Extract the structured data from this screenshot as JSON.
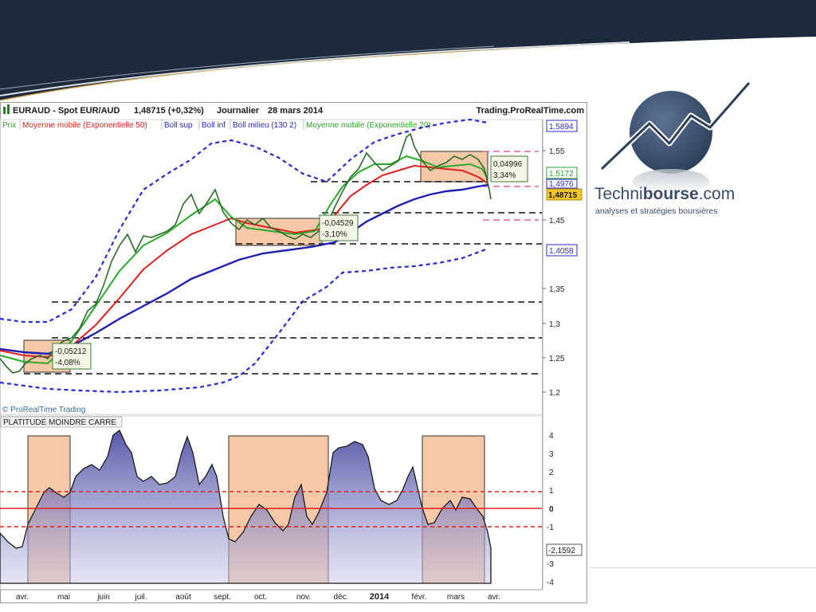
{
  "header": {
    "title": "EURAUD - Spot EUR/AUD",
    "price_change": "1,48715 (+0,32%)",
    "period": "Journalier",
    "date": "28 mars 2014",
    "source": "Trading.ProRealTime.com"
  },
  "legend": {
    "items": [
      {
        "label": "Prix",
        "color": "#4a8f3c"
      },
      {
        "label": "Moyenne mobile (Exponentielle 50)",
        "color": "#e02020"
      },
      {
        "label": "Boll sup",
        "color": "#2a2ad0"
      },
      {
        "label": "Boll inf",
        "color": "#2a2ad0"
      },
      {
        "label": "Boll milieu (130 2)",
        "color": "#2a2ad0"
      },
      {
        "label": "Moyenne mobile (Exponentielle 20)",
        "color": "#2aa82a"
      }
    ]
  },
  "price_panel": {
    "watermark": "© ProRealTime Trading",
    "annotations": [
      {
        "line1": "-0,05212",
        "line2": "-4,08%"
      },
      {
        "line1": "-0,04529",
        "line2": "-3,10%"
      },
      {
        "line1": "0,04996",
        "line2": "3,34%"
      }
    ],
    "badges": {
      "boll_sup": "1,5894",
      "ema20": "1,5172",
      "ema50": "1,4976",
      "last": "1,48715",
      "boll_mid": "1,4058"
    }
  },
  "indicator_panel": {
    "title": "PLATITUDE MOINDRE CARRE",
    "last_value": "-2,1592"
  },
  "branding": {
    "logo_text_light": "Techni",
    "logo_text_bold": "bourse",
    "logo_text_suffix": ".com",
    "tagline": "analyses et stratégies boursières"
  },
  "colors": {
    "banner": "#1c2a3c",
    "accent_line": "#c8a24a",
    "price_candles": "#4a8f3c",
    "ema50": "#e02020",
    "ema20": "#2aa82a",
    "bollinger": "#2a2ad0",
    "boxes": "#f5c9a8",
    "indicator_fill": "#6a6ab0"
  },
  "chart_data": [
    {
      "type": "line",
      "title": "EURAUD - Spot EUR/AUD",
      "x_ticks": [
        "avr.",
        "mai",
        "juin",
        "juil.",
        "août",
        "sept.",
        "oct.",
        "nov.",
        "déc.",
        "2014",
        "févr.",
        "mars",
        "avr."
      ],
      "y_ticks": [
        "1,2",
        "1,25",
        "1,3",
        "1,35",
        "1,45",
        "1,55"
      ],
      "ylim": [
        1.18,
        1.6
      ],
      "grid": false,
      "series": [
        {
          "name": "Prix",
          "x": [
            "avr.",
            "mai",
            "juin",
            "juil.",
            "août",
            "sept.",
            "oct.",
            "nov.",
            "déc.",
            "2014",
            "févr.",
            "mars",
            "avr."
          ],
          "values": [
            1.25,
            1.27,
            1.37,
            1.43,
            1.48,
            1.44,
            1.445,
            1.435,
            1.49,
            1.54,
            1.56,
            1.53,
            1.487
          ]
        },
        {
          "name": "Moyenne mobile (Exponentielle 50)",
          "x": [
            "avr.",
            "mai",
            "juin",
            "juil.",
            "août",
            "sept.",
            "oct.",
            "nov.",
            "déc.",
            "2014",
            "févr.",
            "mars",
            "avr."
          ],
          "values": [
            1.258,
            1.255,
            1.31,
            1.385,
            1.43,
            1.445,
            1.44,
            1.438,
            1.465,
            1.495,
            1.515,
            1.518,
            1.498
          ]
        },
        {
          "name": "Moyenne mobile (Exponentielle 20)",
          "x": [
            "avr.",
            "mai",
            "juin",
            "juil.",
            "août",
            "sept.",
            "oct.",
            "nov.",
            "déc.",
            "2014",
            "févr.",
            "mars",
            "avr."
          ],
          "values": [
            1.255,
            1.26,
            1.35,
            1.41,
            1.45,
            1.445,
            1.44,
            1.436,
            1.48,
            1.52,
            1.535,
            1.53,
            1.517
          ]
        },
        {
          "name": "Boll milieu (130 2)",
          "x": [
            "avr.",
            "mai",
            "juin",
            "juil.",
            "août",
            "sept.",
            "oct.",
            "nov.",
            "déc.",
            "2014",
            "févr.",
            "mars",
            "avr."
          ],
          "values": [
            1.265,
            1.255,
            1.275,
            1.315,
            1.355,
            1.39,
            1.405,
            1.415,
            1.43,
            1.45,
            1.475,
            1.49,
            1.497
          ]
        },
        {
          "name": "Boll sup",
          "x": [
            "avr.",
            "mai",
            "juin",
            "juil.",
            "août",
            "sept.",
            "oct.",
            "nov.",
            "déc.",
            "2014",
            "févr.",
            "mars",
            "avr."
          ],
          "values": [
            1.31,
            1.32,
            1.39,
            1.47,
            1.54,
            1.56,
            1.55,
            1.51,
            1.53,
            1.565,
            1.58,
            1.595,
            1.59
          ]
        },
        {
          "name": "Boll inf",
          "x": [
            "avr.",
            "mai",
            "juin",
            "juil.",
            "août",
            "sept.",
            "oct.",
            "nov.",
            "déc.",
            "2014",
            "févr.",
            "mars",
            "avr."
          ],
          "values": [
            1.215,
            1.21,
            1.205,
            1.21,
            1.215,
            1.22,
            1.25,
            1.32,
            1.37,
            1.38,
            1.38,
            1.39,
            1.405
          ]
        }
      ],
      "support_levels": [
        1.23,
        1.28,
        1.33,
        1.415,
        1.46,
        1.51
      ],
      "pink_levels": [
        1.55,
        1.5,
        1.45
      ]
    },
    {
      "type": "area",
      "title": "PLATITUDE MOINDRE CARRE",
      "x_ticks": [
        "avr.",
        "mai",
        "juin",
        "juil.",
        "août",
        "sept.",
        "oct.",
        "nov.",
        "déc.",
        "2014",
        "févr.",
        "mars",
        "avr."
      ],
      "y_ticks": [
        "4",
        "3",
        "2",
        "1",
        "0",
        "-1",
        "-3",
        "-4"
      ],
      "ylim": [
        -4.2,
        4.6
      ],
      "reference_lines": [
        1,
        0,
        -1
      ],
      "series": [
        {
          "x": [
            "avr.",
            "mai",
            "juin",
            "juil.",
            "août",
            "sept.",
            "oct.",
            "nov.",
            "déc.",
            "2014",
            "févr.",
            "mars",
            "avr."
          ],
          "values": [
            -2.2,
            0.9,
            2.2,
            3.0,
            2.5,
            -1.8,
            0.3,
            0.2,
            3.6,
            2.0,
            1.2,
            0.6,
            -2.16
          ]
        }
      ]
    }
  ]
}
